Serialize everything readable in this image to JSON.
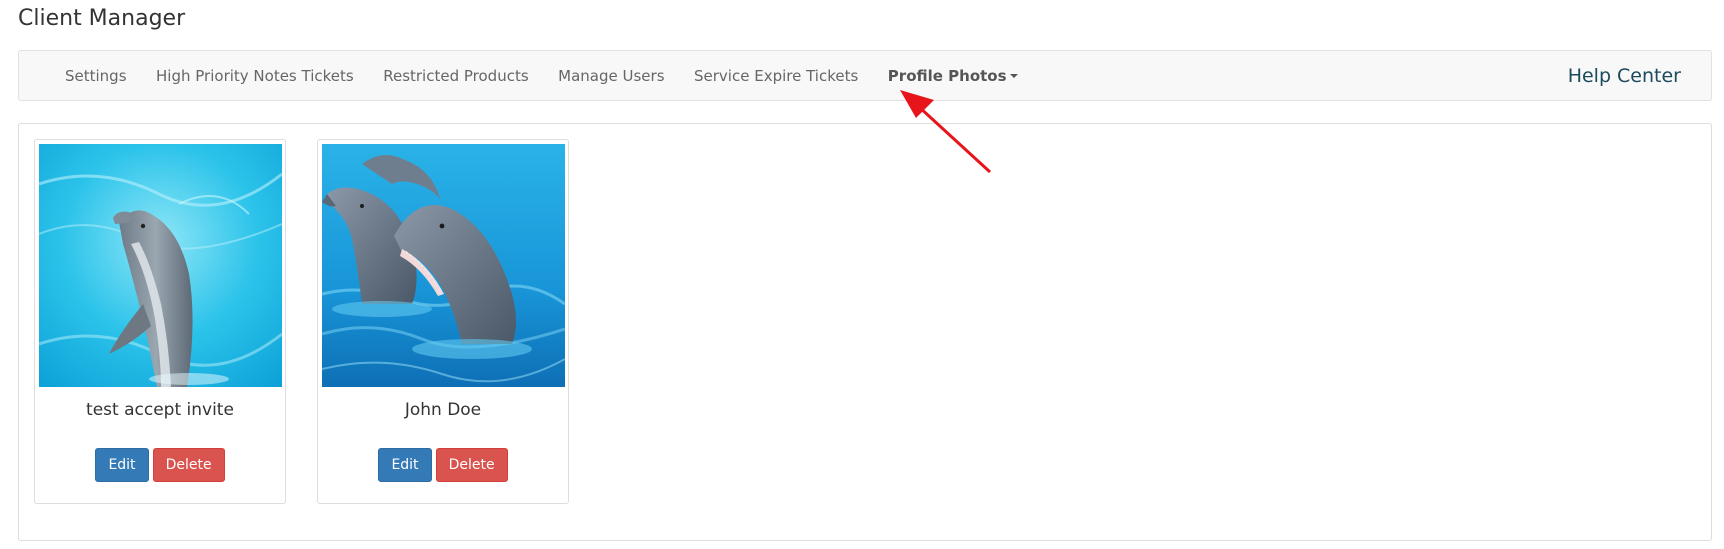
{
  "page": {
    "title": "Client Manager"
  },
  "nav": {
    "items": [
      {
        "label": "Settings",
        "active": false
      },
      {
        "label": "High Priority Notes Tickets",
        "active": false
      },
      {
        "label": "Restricted Products",
        "active": false
      },
      {
        "label": "Manage Users",
        "active": false
      },
      {
        "label": "Service Expire Tickets",
        "active": false
      },
      {
        "label": "Profile Photos",
        "active": true,
        "dropdown": true
      }
    ],
    "help_center": "Help Center"
  },
  "profiles": [
    {
      "name": "test accept invite",
      "photo_icon": "dolphin-photo",
      "edit_label": "Edit",
      "delete_label": "Delete"
    },
    {
      "name": "John Doe",
      "photo_icon": "dolphins-photo",
      "edit_label": "Edit",
      "delete_label": "Delete"
    }
  ],
  "colors": {
    "edit_button": "#337ab7",
    "delete_button": "#d9534f",
    "annotation_arrow": "#e8141b",
    "help_center": "#1b4a5c",
    "water": "#29b6e6"
  }
}
